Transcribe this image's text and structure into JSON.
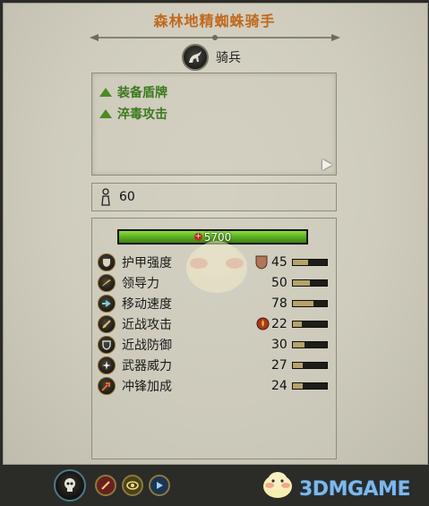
{
  "unit": {
    "name": "森林地精蜘蛛骑手",
    "type_icon": "cavalry-icon",
    "type_label": "骑兵"
  },
  "abilities": [
    {
      "label": "装备盾牌",
      "icon": "triangle-up-icon"
    },
    {
      "label": "淬毒攻击",
      "icon": "triangle-up-icon"
    }
  ],
  "men": {
    "icon": "men-count-icon",
    "value": "60"
  },
  "health": {
    "value": "5700",
    "fill": 1.0,
    "color": "#5fb422"
  },
  "stats": [
    {
      "label": "护甲强度",
      "icon": "armor-icon",
      "extra_icon": "shield-icon",
      "value": "45",
      "fill": 0.45
    },
    {
      "label": "领导力",
      "icon": "leadership-icon",
      "extra_icon": "",
      "value": "50",
      "fill": 0.5
    },
    {
      "label": "移动速度",
      "icon": "speed-icon",
      "extra_icon": "",
      "value": "78",
      "fill": 0.6
    },
    {
      "label": "近战攻击",
      "icon": "melee-attack-icon",
      "extra_icon": "poison-icon",
      "value": "22",
      "fill": 0.25
    },
    {
      "label": "近战防御",
      "icon": "melee-defence-icon",
      "extra_icon": "",
      "value": "30",
      "fill": 0.35
    },
    {
      "label": "武器威力",
      "icon": "weapon-strength-icon",
      "extra_icon": "",
      "value": "27",
      "fill": 0.3
    },
    {
      "label": "冲锋加成",
      "icon": "charge-bonus-icon",
      "extra_icon": "",
      "value": "24",
      "fill": 0.3
    }
  ],
  "bottom_icons": [
    "faction-skull-icon",
    "attribute-icon-1",
    "attribute-icon-2",
    "attribute-icon-3"
  ],
  "watermark": {
    "text": "3DMGAME"
  },
  "colors": {
    "accent": "#c0691c",
    "ability": "#3c7a1e"
  }
}
